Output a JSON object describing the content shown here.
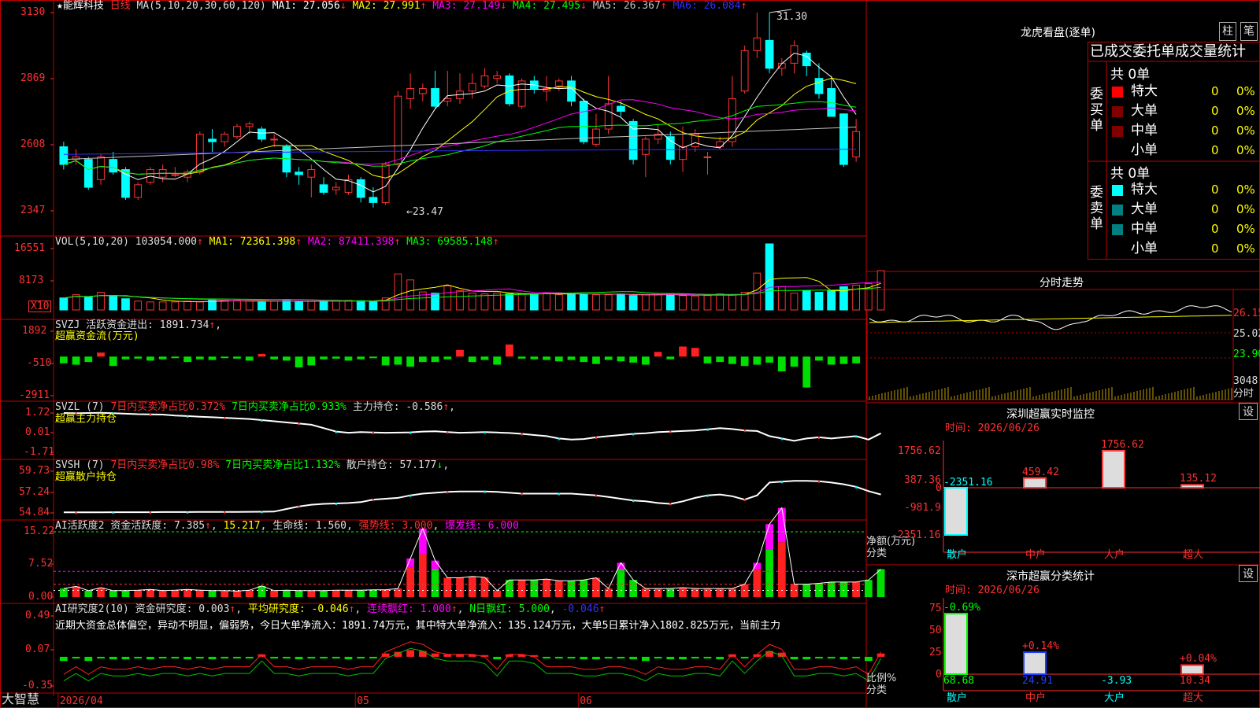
{
  "main": {
    "star_icon": "★",
    "stock_name": "能辉科技",
    "period": "日线",
    "ma_header": "MA(5,10,20,30,60,120)",
    "ma_items": [
      {
        "label": "MA1: 27.056",
        "arrow": "↓",
        "color": "#ffffff"
      },
      {
        "label": "MA2: 27.991",
        "arrow": "↑",
        "color": "#ffff00"
      },
      {
        "label": "MA3: 27.149",
        "arrow": "↓",
        "color": "#ff00ff"
      },
      {
        "label": "MA4: 27.495",
        "arrow": "↓",
        "color": "#00ff00"
      },
      {
        "label": "MA5: 26.367",
        "arrow": "↑",
        "color": "#c0c0c0"
      },
      {
        "label": "MA6: 26.084",
        "arrow": "↑",
        "color": "#3030ff"
      }
    ],
    "y_ticks": [
      "3130",
      "2869",
      "2608",
      "2347"
    ],
    "high_marker": "31.30",
    "low_marker": "←23.47"
  },
  "candles": [
    {
      "o": 26.0,
      "c": 25.3,
      "h": 26.2,
      "l": 25.1
    },
    {
      "o": 25.5,
      "c": 25.6,
      "h": 25.9,
      "l": 25.3
    },
    {
      "o": 25.5,
      "c": 24.4,
      "h": 25.6,
      "l": 24.3
    },
    {
      "o": 24.7,
      "c": 25.6,
      "h": 25.7,
      "l": 24.5
    },
    {
      "o": 25.5,
      "c": 25.0,
      "h": 25.8,
      "l": 24.9
    },
    {
      "o": 25.1,
      "c": 24.0,
      "h": 25.2,
      "l": 23.9
    },
    {
      "o": 24.0,
      "c": 24.5,
      "h": 24.6,
      "l": 23.9
    },
    {
      "o": 24.6,
      "c": 25.1,
      "h": 25.2,
      "l": 24.5
    },
    {
      "o": 24.8,
      "c": 25.1,
      "h": 25.3,
      "l": 24.6
    },
    {
      "o": 24.9,
      "c": 24.9,
      "h": 25.2,
      "l": 24.8
    },
    {
      "o": 24.8,
      "c": 25.0,
      "h": 25.1,
      "l": 24.6
    },
    {
      "o": 25.0,
      "c": 26.5,
      "h": 26.6,
      "l": 24.9
    },
    {
      "o": 26.3,
      "c": 26.2,
      "h": 26.7,
      "l": 25.8
    },
    {
      "o": 26.2,
      "c": 26.5,
      "h": 26.6,
      "l": 26.0
    },
    {
      "o": 26.4,
      "c": 26.8,
      "h": 26.9,
      "l": 26.3
    },
    {
      "o": 26.8,
      "c": 26.9,
      "h": 27.0,
      "l": 26.5
    },
    {
      "o": 26.7,
      "c": 26.3,
      "h": 26.8,
      "l": 26.2
    },
    {
      "o": 26.3,
      "c": 26.3,
      "h": 26.5,
      "l": 26.0
    },
    {
      "o": 26.0,
      "c": 25.0,
      "h": 26.1,
      "l": 24.8
    },
    {
      "o": 25.0,
      "c": 24.9,
      "h": 25.2,
      "l": 24.5
    },
    {
      "o": 24.8,
      "c": 25.1,
      "h": 25.3,
      "l": 24.0
    },
    {
      "o": 24.5,
      "c": 24.2,
      "h": 24.8,
      "l": 24.1
    },
    {
      "o": 24.3,
      "c": 24.4,
      "h": 24.6,
      "l": 24.1
    },
    {
      "o": 24.2,
      "c": 24.7,
      "h": 24.9,
      "l": 24.1
    },
    {
      "o": 24.7,
      "c": 24.0,
      "h": 24.8,
      "l": 23.8
    },
    {
      "o": 24.0,
      "c": 23.8,
      "h": 24.4,
      "l": 23.6
    },
    {
      "o": 23.8,
      "c": 25.3,
      "h": 25.4,
      "l": 23.7
    },
    {
      "o": 25.3,
      "c": 28.0,
      "h": 28.2,
      "l": 25.2
    },
    {
      "o": 27.9,
      "c": 28.3,
      "h": 28.9,
      "l": 27.5
    },
    {
      "o": 28.1,
      "c": 28.3,
      "h": 28.5,
      "l": 27.8
    },
    {
      "o": 28.3,
      "c": 27.6,
      "h": 29.0,
      "l": 27.5
    },
    {
      "o": 27.8,
      "c": 27.9,
      "h": 29.0,
      "l": 27.6
    },
    {
      "o": 27.9,
      "c": 28.2,
      "h": 28.9,
      "l": 27.7
    },
    {
      "o": 28.2,
      "c": 28.5,
      "h": 28.9,
      "l": 27.9
    },
    {
      "o": 28.4,
      "c": 28.8,
      "h": 29.1,
      "l": 28.3
    },
    {
      "o": 28.7,
      "c": 28.8,
      "h": 29.0,
      "l": 28.5
    },
    {
      "o": 28.8,
      "c": 27.7,
      "h": 28.9,
      "l": 27.6
    },
    {
      "o": 27.6,
      "c": 28.6,
      "h": 28.7,
      "l": 27.5
    },
    {
      "o": 28.6,
      "c": 28.3,
      "h": 28.8,
      "l": 28.1
    },
    {
      "o": 28.2,
      "c": 28.3,
      "h": 28.8,
      "l": 27.8
    },
    {
      "o": 28.4,
      "c": 28.6,
      "h": 28.7,
      "l": 28.2
    },
    {
      "o": 28.6,
      "c": 27.8,
      "h": 28.8,
      "l": 27.6
    },
    {
      "o": 27.8,
      "c": 26.2,
      "h": 27.9,
      "l": 26.1
    },
    {
      "o": 26.1,
      "c": 26.7,
      "h": 27.3,
      "l": 26.0
    },
    {
      "o": 26.7,
      "c": 27.7,
      "h": 28.8,
      "l": 26.5
    },
    {
      "o": 27.6,
      "c": 27.4,
      "h": 27.8,
      "l": 27.2
    },
    {
      "o": 27.0,
      "c": 25.5,
      "h": 27.1,
      "l": 25.3
    },
    {
      "o": 25.7,
      "c": 26.3,
      "h": 26.4,
      "l": 24.8
    },
    {
      "o": 26.3,
      "c": 26.5,
      "h": 26.9,
      "l": 26.1
    },
    {
      "o": 26.4,
      "c": 25.5,
      "h": 26.6,
      "l": 25.3
    },
    {
      "o": 25.5,
      "c": 26.0,
      "h": 26.8,
      "l": 25.0
    },
    {
      "o": 26.0,
      "c": 26.5,
      "h": 26.7,
      "l": 25.8
    },
    {
      "o": 25.6,
      "c": 25.6,
      "h": 25.8,
      "l": 24.9
    },
    {
      "o": 26.0,
      "c": 26.2,
      "h": 26.4,
      "l": 25.9
    },
    {
      "o": 26.2,
      "c": 27.9,
      "h": 28.8,
      "l": 26.0
    },
    {
      "o": 28.2,
      "c": 29.8,
      "h": 30.0,
      "l": 28.1
    },
    {
      "o": 29.8,
      "c": 30.3,
      "h": 31.3,
      "l": 29.5
    },
    {
      "o": 30.2,
      "c": 29.1,
      "h": 31.3,
      "l": 28.9
    },
    {
      "o": 29.1,
      "c": 29.3,
      "h": 29.5,
      "l": 28.8
    },
    {
      "o": 29.3,
      "c": 30.0,
      "h": 30.2,
      "l": 28.9
    },
    {
      "o": 29.7,
      "c": 29.2,
      "h": 29.8,
      "l": 28.8
    },
    {
      "o": 28.7,
      "c": 28.1,
      "h": 29.3,
      "l": 27.9
    },
    {
      "o": 28.3,
      "c": 27.2,
      "h": 28.8,
      "l": 27.2
    },
    {
      "o": 27.3,
      "c": 25.3,
      "h": 27.3,
      "l": 25.2
    },
    {
      "o": 25.6,
      "c": 26.6,
      "h": 27.1,
      "l": 25.4
    }
  ],
  "vol": {
    "header": "VOL(5,10,20) 103054.000",
    "arrow": "↑",
    "items": [
      {
        "label": "MA1: 72361.398",
        "arrow": "↑",
        "color": "#ffff00"
      },
      {
        "label": "MA2: 87411.398",
        "arrow": "↑",
        "color": "#ff00ff"
      },
      {
        "label": "MA3: 69585.148",
        "arrow": "↑",
        "color": "#00ff00"
      }
    ],
    "y_ticks": [
      "16551",
      "8173"
    ],
    "unit_label": "X10",
    "values": [
      30,
      38,
      32,
      44,
      36,
      28,
      22,
      20,
      20,
      20,
      22,
      20,
      25,
      24,
      24,
      22,
      20,
      22,
      24,
      20,
      22,
      22,
      22,
      24,
      23,
      22,
      30,
      90,
      75,
      45,
      42,
      60,
      48,
      42,
      40,
      42,
      40,
      40,
      38,
      42,
      38,
      42,
      40,
      38,
      38,
      40,
      36,
      38,
      38,
      40,
      36,
      35,
      36,
      40,
      38,
      44,
      92,
      165,
      58,
      42,
      48,
      44,
      48,
      58,
      62,
      66,
      98
    ]
  },
  "svzj": {
    "name": "SVZJ",
    "header": "活跃资金进出: 1891.734",
    "arrow": "↑",
    "sub": "超赢资金流(万元)",
    "y_ticks": [
      "1892",
      "-510",
      "-2911"
    ],
    "values": [
      -500,
      -600,
      -400,
      300,
      -700,
      -200,
      -150,
      -300,
      -200,
      -100,
      -400,
      -200,
      -250,
      -100,
      -150,
      -300,
      200,
      -200,
      -300,
      -800,
      -650,
      -200,
      -150,
      -300,
      -200,
      -100,
      -650,
      -600,
      -750,
      -400,
      -400,
      -200,
      500,
      -400,
      -250,
      -600,
      900,
      -150,
      -200,
      -250,
      -350,
      -250,
      -400,
      -550,
      -250,
      -350,
      -450,
      -600,
      350,
      -200,
      750,
      650,
      -500,
      -400,
      -550,
      -700,
      -600,
      -450,
      -1100,
      -750,
      -2300,
      -300,
      -600,
      -550,
      -500,
      -650,
      -1300,
      1900
    ],
    "colors_note": "positive red, negative green"
  },
  "svzl": {
    "name": "SVZL (7)",
    "item1": "7日内买卖净占比0.372%",
    "item2": "7日内买卖净占比0.933%",
    "item3": "主力持仓: -0.586",
    "arrow": "↑",
    "sub": "超赢主力持仓",
    "y_ticks": [
      "1.72",
      "0.01",
      "-1.71"
    ],
    "values": [
      1.72,
      1.7,
      1.72,
      1.74,
      1.7,
      1.66,
      1.62,
      1.6,
      1.58,
      1.5,
      1.45,
      1.4,
      1.35,
      1.3,
      1.25,
      1.2,
      1.1,
      1.0,
      0.9,
      0.8,
      0.7,
      0.4,
      0.1,
      0.0,
      0.05,
      0.02,
      0.0,
      0.01,
      0.03,
      0.1,
      0.12,
      0.05,
      0.0,
      0.02,
      0.06,
      0.02,
      -0.02,
      -0.1,
      -0.2,
      -0.3,
      -0.5,
      -0.6,
      -0.55,
      -0.4,
      -0.3,
      -0.2,
      -0.1,
      -0.05,
      0.05,
      0.1,
      0.15,
      0.2,
      0.3,
      0.4,
      0.32,
      0.2,
      0.15,
      -0.3,
      -0.5,
      -0.7,
      -0.5,
      -0.4,
      -0.5,
      -0.4,
      -0.3,
      -0.6,
      -0.05
    ]
  },
  "svsh": {
    "name": "SVSH (7)",
    "item1": "7日内买卖净占比0.98%",
    "item2": "7日内买卖净占比1.132%",
    "item3": "散户持仓: 57.177",
    "arrow": "↓",
    "sub": "超赢散户持仓",
    "y_ticks": [
      "59.73",
      "57.24",
      "54.84"
    ],
    "values": [
      54.9,
      54.9,
      54.9,
      54.9,
      54.92,
      54.92,
      54.92,
      54.92,
      54.94,
      54.94,
      54.94,
      54.95,
      54.96,
      54.96,
      54.96,
      54.97,
      54.98,
      55.0,
      55.3,
      55.6,
      55.8,
      55.9,
      55.95,
      56.0,
      56.1,
      56.4,
      56.5,
      56.6,
      56.9,
      57.1,
      57.2,
      57.3,
      57.35,
      57.35,
      57.36,
      57.3,
      57.2,
      57.1,
      57.1,
      57.1,
      57.1,
      57.1,
      57.0,
      56.9,
      56.7,
      56.5,
      56.3,
      56.2,
      56.0,
      55.9,
      56.2,
      56.6,
      56.9,
      57.0,
      56.8,
      56.4,
      56.9,
      58.4,
      58.5,
      58.6,
      58.6,
      58.55,
      58.4,
      58.2,
      57.9,
      57.4,
      57.0
    ]
  },
  "ai_active": {
    "title": "AI活跃度2",
    "item1": "资金活跃度: 7.385",
    "item1_arrow": "↑",
    "item2": "15.217",
    "item3": "生命线: 1.560",
    "item4": "强势线: 3.000",
    "item5": "爆发线: 6.000",
    "y_ticks": [
      "15.22",
      "7.52",
      "0.00"
    ],
    "values": [
      2,
      2.5,
      1.5,
      2.2,
      1.5,
      1.5,
      1.6,
      1.8,
      1.5,
      1.6,
      1.8,
      1.6,
      1.5,
      1.5,
      1.4,
      1.6,
      2.6,
      1.5,
      1.6,
      1.5,
      1.5,
      1.5,
      1.6,
      1.6,
      1.6,
      1.7,
      1.7,
      2.0,
      7.0,
      10.0,
      6.5,
      4.5,
      4.5,
      4.8,
      4.6,
      1.5,
      4.0,
      4.0,
      4.0,
      4.2,
      3.8,
      3.8,
      4.0,
      4.5,
      2.0,
      6.5,
      4.0,
      2.0,
      2.0,
      2.0,
      2.2,
      2.0,
      2.0,
      2.0,
      2.0,
      3.0,
      6.5,
      11.0,
      12.8,
      3.0,
      3.0,
      3.2,
      3.5,
      3.5,
      3.5,
      4.0,
      6.5
    ],
    "magenta": [
      0,
      0,
      0,
      0,
      0,
      0,
      0,
      0,
      0,
      0,
      0,
      0,
      0,
      0,
      0,
      0,
      0,
      0,
      0,
      0,
      0,
      0,
      0,
      0,
      0,
      0,
      0,
      0,
      2.0,
      6.0,
      2.0,
      0,
      0,
      0,
      0,
      0,
      0,
      0,
      0,
      0,
      0,
      0,
      0,
      0,
      0,
      1.5,
      0,
      0,
      0,
      0,
      0,
      0,
      0,
      0,
      0,
      0,
      1.5,
      6.0,
      8.0,
      0,
      0,
      0,
      0,
      0,
      0,
      0,
      0
    ]
  },
  "ai_research": {
    "title": "AI研究度2(10)",
    "item1": "资金研究度: 0.003",
    "item1_arrow": "↑",
    "item2": "平均研究度: -0.046",
    "item2_arrow": "↑",
    "item3": "连续飘红: 1.000",
    "item3_arrow": "↑",
    "item4": "N日飘红: 5.000",
    "item5": "-0.046",
    "item5_arrow": "↑",
    "comment": "近期大资金总体偏空，异动不明显，偏弱势，今日大单净流入：1891.74万元，其中特大单净流入：135.124万元，大单5日累计净入1802.825万元，当前主力",
    "y_ticks": [
      "0.49",
      "0.07",
      "-0.35"
    ],
    "values": [
      -0.05,
      -0.02,
      -0.05,
      -0.02,
      -0.03,
      -0.03,
      -0.02,
      -0.03,
      -0.02,
      -0.02,
      -0.03,
      -0.02,
      -0.03,
      -0.02,
      -0.02,
      -0.02,
      0.03,
      -0.02,
      -0.02,
      -0.03,
      -0.02,
      -0.02,
      -0.02,
      -0.03,
      -0.02,
      -0.02,
      0.04,
      0.06,
      0.08,
      0.07,
      0.04,
      0.03,
      0.03,
      0.03,
      0.02,
      -0.03,
      0.03,
      0.03,
      0.02,
      -0.02,
      -0.02,
      -0.02,
      -0.03,
      -0.03,
      -0.02,
      -0.02,
      -0.03,
      -0.05,
      -0.02,
      -0.03,
      -0.03,
      -0.02,
      -0.02,
      -0.03,
      0.03,
      -0.02,
      0.03,
      0.07,
      0.05,
      -0.03,
      -0.03,
      -0.02,
      -0.02,
      -0.03,
      -0.02,
      -0.05,
      0.04
    ]
  },
  "xaxis": {
    "labels": [
      {
        "i": 0,
        "t": "2026/04"
      },
      {
        "i": 24,
        "t": "05"
      },
      {
        "i": 42,
        "t": "06"
      }
    ],
    "footer_brand": "大智慧"
  },
  "side": {
    "title": "龙虎看盘(逐单)",
    "btn_bar": "柱",
    "btn_pen": "笔",
    "tab_label": "已成交委托单成交量统计",
    "buy": {
      "label": "委买单",
      "total": "共 0单",
      "rows": [
        {
          "name": "特大",
          "val": "0",
          "pct": "0%",
          "color": "#ff0000"
        },
        {
          "name": "大单",
          "val": "0",
          "pct": "0%",
          "color": "#800000"
        },
        {
          "name": "中单",
          "val": "0",
          "pct": "0%",
          "color": "#800000"
        },
        {
          "name": "小单",
          "val": "0",
          "pct": "0%",
          "color": ""
        }
      ]
    },
    "sell": {
      "label": "委卖单",
      "total": "共 0单",
      "rows": [
        {
          "name": "特大",
          "val": "0",
          "pct": "0%",
          "color": "#00ffff"
        },
        {
          "name": "大单",
          "val": "0",
          "pct": "0%",
          "color": "#008080"
        },
        {
          "name": "中单",
          "val": "0",
          "pct": "0%",
          "color": "#008080"
        },
        {
          "name": "小单",
          "val": "0",
          "pct": "0%",
          "color": ""
        }
      ]
    },
    "intraday": {
      "title": "分时走势",
      "prices": [
        "26.15",
        "25.02",
        "23.90"
      ],
      "vol_label": "3048",
      "foot": "分时"
    },
    "monitor": {
      "title": "深圳超赢实时监控",
      "btn": "设",
      "time": "时间: 2026/06/26",
      "y_ticks": [
        "1756.62",
        "387.36",
        "0",
        "-981.9",
        "-2351.16"
      ],
      "bars": [
        {
          "cat": "散户",
          "value": -2351.16,
          "label": "-2351.16",
          "color": "#00ffff"
        },
        {
          "cat": "中户",
          "value": 459.42,
          "label": "459.42",
          "color": "#ff4040"
        },
        {
          "cat": "大户",
          "value": 1756.62,
          "label": "1756.62",
          "color": "#ff4040"
        },
        {
          "cat": "超大",
          "value": 135.12,
          "label": "135.12",
          "color": "#ff4040"
        }
      ],
      "unit": "净额(万元)",
      "foot": "分类"
    },
    "stats": {
      "title": "深市超赢分类统计",
      "btn": "设",
      "time": "时间: 2026/06/26",
      "y_ticks": [
        "75",
        "50",
        "25",
        "0"
      ],
      "bars": [
        {
          "cat": "散户",
          "value": 68.68,
          "top": "-0.69%",
          "bottom": "68.68",
          "color": "#00ff00"
        },
        {
          "cat": "中户",
          "value": 24.91,
          "top": "+0.14%",
          "bottom": "24.91",
          "color": "#2040ff"
        },
        {
          "cat": "大户",
          "value": -3.93,
          "top": "",
          "bottom": "-3.93",
          "color": "#00ffff"
        },
        {
          "cat": "超大",
          "value": 10.34,
          "top": "+0.04%",
          "bottom": "10.34",
          "color": "#ff2020"
        }
      ],
      "unit": "比例%",
      "foot": "分类"
    }
  }
}
